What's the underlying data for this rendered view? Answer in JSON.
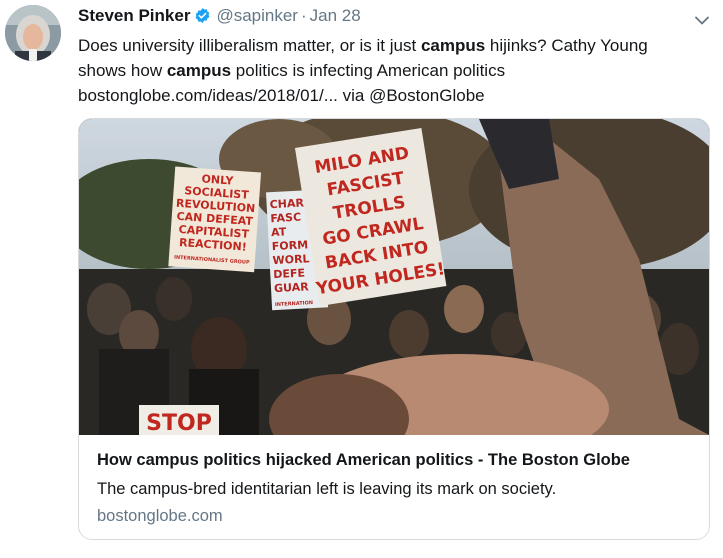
{
  "tweet": {
    "author_name": "Steven Pinker",
    "handle": "@sapinker",
    "separator": "·",
    "date": "Jan 28",
    "verified_icon": "verified-badge-icon",
    "menu_icon": "chevron-down-icon",
    "text_parts": [
      {
        "t": "Does university illiberalism matter, or is it just ",
        "bold": false
      },
      {
        "t": "campus",
        "bold": true
      },
      {
        "t": " hijinks? Cathy Young shows how ",
        "bold": false
      },
      {
        "t": "campus",
        "bold": true
      },
      {
        "t": " politics is infecting American politics bostonglobe.com/ideas/2018/01/... via @BostonGlobe",
        "bold": false
      }
    ]
  },
  "card": {
    "title": "How campus politics hijacked American politics - The Boston Globe",
    "description": "The campus-bred identitarian left is leaving its mark on society.",
    "domain": "bostonglobe.com",
    "image_signs": {
      "sign1": [
        "ONLY",
        "SOCIALIST",
        "REVOLUTION",
        "CAN DEFEAT",
        "CAPITALIST",
        "REACTION!",
        "INTERNATIONALIST GROUP"
      ],
      "sign2": [
        "CHARI",
        "FASC",
        "AT",
        "FORM",
        "WORL",
        "DEFE",
        "GUAR",
        "INTERNATION"
      ],
      "sign3": [
        "MILO AND",
        "FASCIST",
        "TROLLS",
        "GO CRAWL",
        "BACK INTO",
        "YOUR HOLES!"
      ],
      "sign4": [
        "STOP"
      ]
    }
  },
  "colors": {
    "text": "#14171a",
    "secondary": "#657786",
    "verified": "#1da1f2",
    "border": "#d6dbe0",
    "sign_red": "#c0271f"
  }
}
